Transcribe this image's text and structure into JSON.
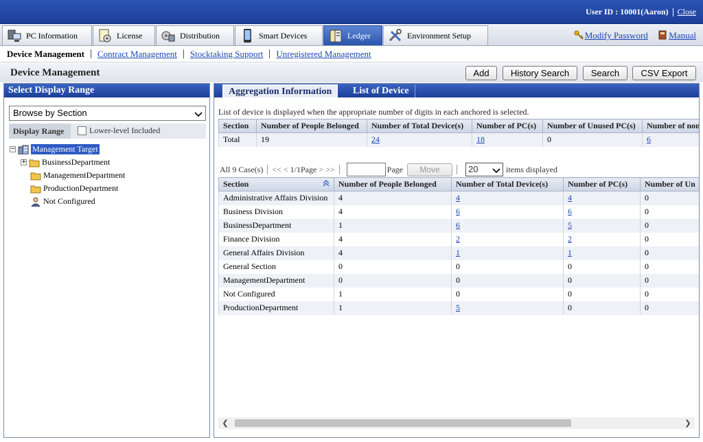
{
  "header": {
    "user_label": "User ID : 10001(Aaron)",
    "close_label": "Close"
  },
  "tabs": [
    {
      "label": "PC Information",
      "icon": "pc-icon"
    },
    {
      "label": "License",
      "icon": "license-icon"
    },
    {
      "label": "Distribution",
      "icon": "distribution-icon"
    },
    {
      "label": "Smart Devices",
      "icon": "smart-device-icon"
    },
    {
      "label": "Ledger",
      "icon": "ledger-icon",
      "active": true
    },
    {
      "label": "Environment Setup",
      "icon": "tools-icon"
    }
  ],
  "top_links": {
    "modify_password": "Modify Password",
    "manual": "Manual"
  },
  "submenu": {
    "current": "Device Management",
    "items": [
      "Contract Management",
      "Stocktaking Support",
      "Unregistered Management"
    ]
  },
  "page": {
    "title": "Device Management",
    "buttons": {
      "add": "Add",
      "history_search": "History Search",
      "search": "Search",
      "csv_export": "CSV Export"
    }
  },
  "left_panel": {
    "title": "Select Display Range",
    "browse_select": "Browse by Section",
    "display_range_label": "Display Range",
    "lower_level_label": "Lower-level Included",
    "tree": {
      "root": "Management Target",
      "children": [
        "BusinessDepartment",
        "ManagementDepartment",
        "ProductionDepartment",
        "Not Configured"
      ]
    }
  },
  "right_panel": {
    "tabs": [
      "Aggregation Information",
      "List of Device"
    ],
    "notice": "List of device is displayed when the appropriate number of digits in each anchored is selected.",
    "summary": {
      "headers": [
        "Section",
        "Number of People Belonged",
        "Number of Total Device(s)",
        "Number of PC(s)",
        "Number of Unused PC(s)",
        "Number of non"
      ],
      "row": [
        "Total",
        "19",
        "24",
        "18",
        "0",
        "6"
      ]
    },
    "pager": {
      "count": "All 9 Case(s)",
      "first": "<<",
      "prev": "<",
      "page_info": "1/1Page",
      "next": ">",
      "last": ">>",
      "page_label": "Page",
      "page_value": "",
      "move_label": "Move",
      "page_size": "20",
      "items_displayed": "items displayed"
    },
    "detail": {
      "headers": [
        "Section",
        "Number of People Belonged",
        "Number of Total Device(s)",
        "Number of PC(s)",
        "Number of Un"
      ],
      "rows": [
        [
          "Administrative Affairs Division",
          "4",
          "4",
          "4",
          "0"
        ],
        [
          "Business Division",
          "4",
          "6",
          "6",
          "0"
        ],
        [
          "BusinessDepartment",
          "1",
          "6",
          "5",
          "0"
        ],
        [
          "Finance Division",
          "4",
          "2",
          "2",
          "0"
        ],
        [
          "General Affairs Division",
          "4",
          "1",
          "1",
          "0"
        ],
        [
          "General Section",
          "0",
          "0",
          "0",
          "0"
        ],
        [
          "ManagementDepartment",
          "0",
          "0",
          "0",
          "0"
        ],
        [
          "Not Configured",
          "1",
          "0",
          "0",
          "0"
        ],
        [
          "ProductionDepartment",
          "1",
          "5",
          "0",
          "0"
        ]
      ]
    }
  },
  "colors": {
    "header_blue": "#1c3f98",
    "link_blue": "#1a46b4",
    "selected_bg": "#2e5bc4"
  }
}
